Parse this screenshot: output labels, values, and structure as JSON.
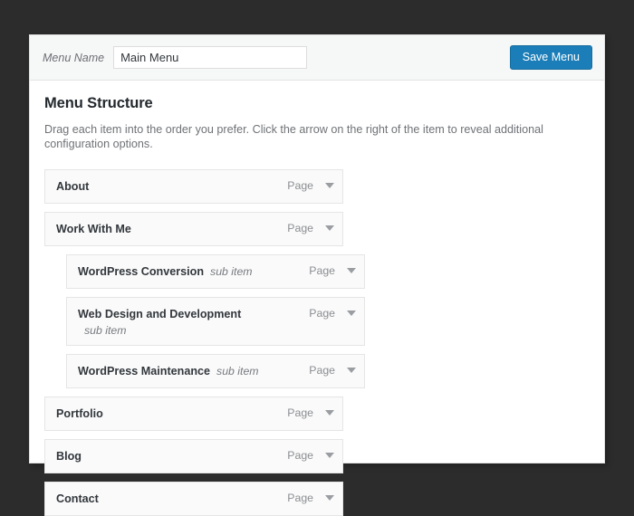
{
  "header": {
    "menu_name_label": "Menu Name",
    "menu_name_value": "Main Menu",
    "menu_name_placeholder": "Menu Name",
    "save_label": "Save Menu",
    "save_color": "#1b7eb8"
  },
  "structure": {
    "title": "Menu Structure",
    "description": "Drag each item into the order you prefer. Click the arrow on the right of the item to reveal additional configuration options."
  },
  "items": [
    {
      "title": "About",
      "depth": 0,
      "sub_flag": "",
      "type": "Page",
      "toggle_icon": "chevron-down-icon",
      "wrap_sub_flag": false
    },
    {
      "title": "Work With Me",
      "depth": 0,
      "sub_flag": "",
      "type": "Page",
      "toggle_icon": "chevron-down-icon",
      "wrap_sub_flag": false
    },
    {
      "title": "WordPress Conversion",
      "depth": 1,
      "sub_flag": "sub item",
      "type": "Page",
      "toggle_icon": "chevron-down-icon",
      "wrap_sub_flag": false
    },
    {
      "title": "Web Design and Development",
      "depth": 1,
      "sub_flag": "sub item",
      "type": "Page",
      "toggle_icon": "chevron-down-icon",
      "wrap_sub_flag": true
    },
    {
      "title": "WordPress Maintenance",
      "depth": 1,
      "sub_flag": "sub item",
      "type": "Page",
      "toggle_icon": "chevron-down-icon",
      "wrap_sub_flag": false
    },
    {
      "title": "Portfolio",
      "depth": 0,
      "sub_flag": "",
      "type": "Page",
      "toggle_icon": "chevron-down-icon",
      "wrap_sub_flag": false
    },
    {
      "title": "Blog",
      "depth": 0,
      "sub_flag": "",
      "type": "Page",
      "toggle_icon": "chevron-down-icon",
      "wrap_sub_flag": false
    },
    {
      "title": "Contact",
      "depth": 0,
      "sub_flag": "",
      "type": "Page",
      "toggle_icon": "chevron-down-icon",
      "wrap_sub_flag": false
    }
  ]
}
